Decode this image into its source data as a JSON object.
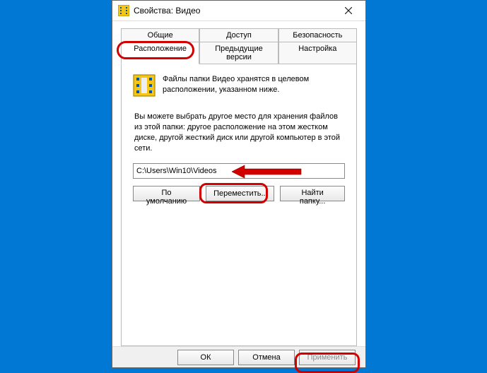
{
  "window": {
    "title": "Свойства: Видео"
  },
  "tabs": {
    "row1": [
      "Общие",
      "Доступ",
      "Безопасность"
    ],
    "row2": [
      "Расположение",
      "Предыдущие версии",
      "Настройка"
    ],
    "activeIndex": "Расположение"
  },
  "content": {
    "desc": "Файлы папки Видео хранятся в целевом расположении, указанном ниже.",
    "instr": "Вы можете выбрать другое место для хранения файлов из этой папки: другое расположение на этом жестком диске, другой жесткий диск или другой компьютер в этой сети.",
    "path": "C:\\Users\\Win10\\Videos",
    "buttons": {
      "default": "По умолчанию",
      "move": "Переместить...",
      "find": "Найти папку..."
    }
  },
  "footer": {
    "ok": "ОК",
    "cancel": "Отмена",
    "apply": "Применить"
  }
}
